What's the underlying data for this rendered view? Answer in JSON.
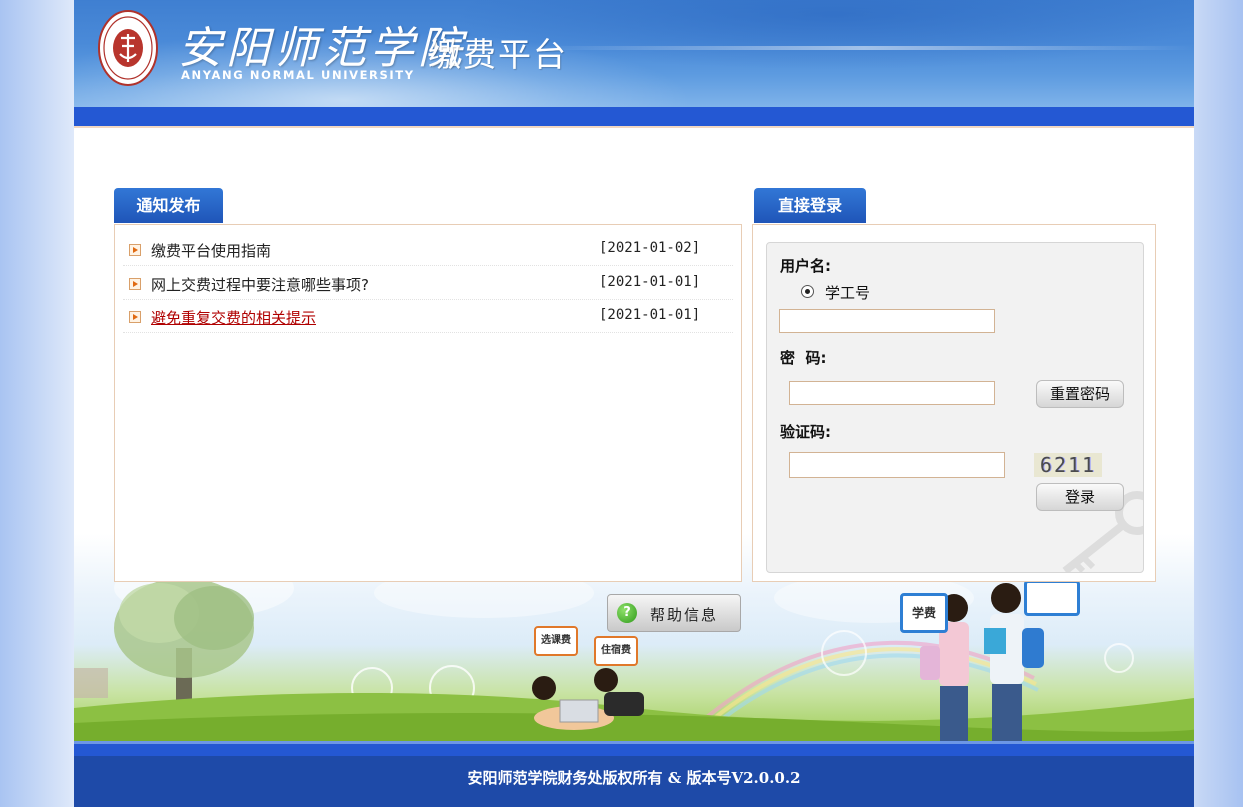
{
  "header": {
    "school_name_cn": "安阳师范学院",
    "school_name_en": "ANYANG NORMAL UNIVERSITY",
    "platform_title": "缴费平台"
  },
  "notice_panel": {
    "tab_label": "通知发布",
    "items": [
      {
        "title": "缴费平台使用指南",
        "date": "[2021-01-02]",
        "highlight": false
      },
      {
        "title": "网上交费过程中要注意哪些事项?",
        "date": "[2021-01-01]",
        "highlight": false
      },
      {
        "title": "避免重复交费的相关提示",
        "date": "[2021-01-01]",
        "highlight": true
      }
    ]
  },
  "login_panel": {
    "tab_label": "直接登录",
    "username_label": "用户名:",
    "radio_option": "学工号",
    "username_value": "",
    "password_label": "密  码:",
    "password_value": "",
    "reset_password_button": "重置密码",
    "captcha_label": "验证码:",
    "captcha_value": "",
    "captcha_image_text": "6211",
    "login_button": "登录"
  },
  "help_button": "帮助信息",
  "banner_bubbles": {
    "xuefei": "学费",
    "xuankefei": "选课费",
    "zhusufei": "住宿费"
  },
  "footer": {
    "copyright": "安阳师范学院财务处版权所有 & 版本号V2.0.0.2"
  },
  "colors": {
    "header_blue": "#4a8ad8",
    "bar_blue": "#2458d3",
    "footer_blue": "#1e4aa8",
    "tab_blue": "#2a66c8",
    "panel_border": "#e8cdb5",
    "highlight_red": "#b00000"
  }
}
